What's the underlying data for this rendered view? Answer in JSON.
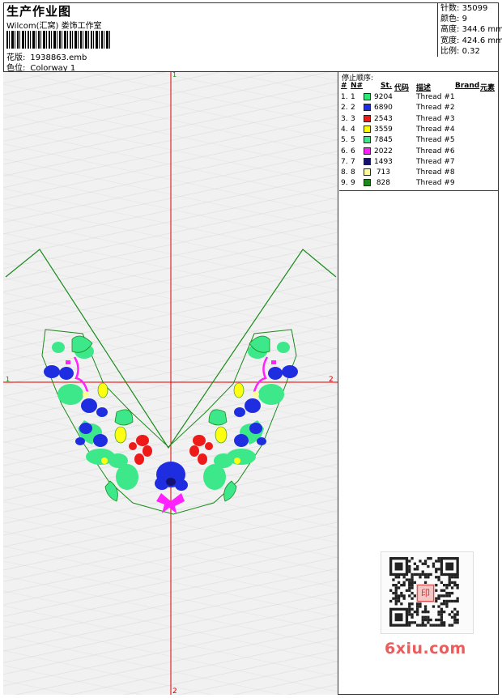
{
  "header": {
    "title": "生产作业图",
    "studio": "Wilcom(汇窝)  娄饰工作室",
    "file_label": "花版:",
    "file_value": "1938863.emb",
    "color_label": "色位:",
    "color_value": "Colorway 1"
  },
  "stats": [
    {
      "label": "针数:",
      "value": "35099"
    },
    {
      "label": "颜色:",
      "value": "9"
    },
    {
      "label": "高度:",
      "value": "344.6 mm"
    },
    {
      "label": "宽度:",
      "value": "424.6 mm"
    },
    {
      "label": "比例:",
      "value": "0.32"
    }
  ],
  "stop_sequence": {
    "title": "停止顺序:",
    "headers": {
      "num": "#",
      "n": "N#",
      "st": "St.",
      "code": "代码",
      "desc": "描述",
      "brand": "Brand",
      "elem": "元素"
    },
    "rows": [
      {
        "n": "1.",
        "nn": "1",
        "color": "#2ee87a",
        "stitches": "9204",
        "desc": "Thread #1"
      },
      {
        "n": "2.",
        "nn": "2",
        "color": "#1f2de0",
        "stitches": "6890",
        "desc": "Thread #2"
      },
      {
        "n": "3.",
        "nn": "3",
        "color": "#ee1a1a",
        "stitches": "2543",
        "desc": "Thread #3"
      },
      {
        "n": "4.",
        "nn": "4",
        "color": "#ffff11",
        "stitches": "3559",
        "desc": "Thread #4"
      },
      {
        "n": "5.",
        "nn": "5",
        "color": "#3de88a",
        "stitches": "7845",
        "desc": "Thread #5"
      },
      {
        "n": "6.",
        "nn": "6",
        "color": "#ff22ff",
        "stitches": "2022",
        "desc": "Thread #6"
      },
      {
        "n": "7.",
        "nn": "7",
        "color": "#13126e",
        "stitches": "1493",
        "desc": "Thread #7"
      },
      {
        "n": "8.",
        "nn": "8",
        "color": "#ffff99",
        "stitches": "713",
        "desc": "Thread #8"
      },
      {
        "n": "9.",
        "nn": "9",
        "color": "#1a8a1a",
        "stitches": "828",
        "desc": "Thread #9"
      }
    ]
  },
  "axes": {
    "top": "1",
    "left": "1",
    "right": "2",
    "bottom": "2"
  },
  "watermark": "6xiu.com",
  "qr_stamp": "印"
}
